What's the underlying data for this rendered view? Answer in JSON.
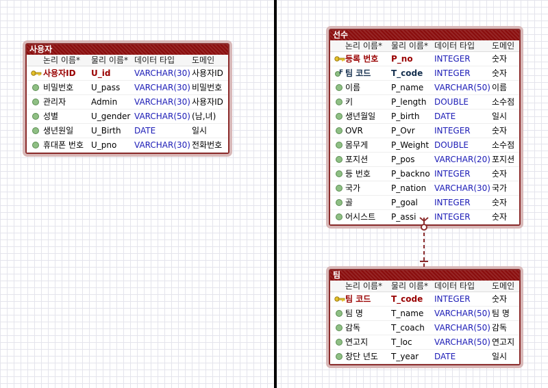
{
  "headers": {
    "logical": "논리 이름",
    "physical": "물리 이름",
    "datatype": "데이터 타입",
    "domain": "도메인"
  },
  "entities": {
    "user": {
      "title": "사용자",
      "rows": [
        {
          "logical": "사용자ID",
          "physical": "U_id",
          "type": "VARCHAR(30)",
          "domain": "사용자ID",
          "key": "pk"
        },
        {
          "logical": "비밀번호",
          "physical": "U_pass",
          "type": "VARCHAR(30)",
          "domain": "비밀번호",
          "key": ""
        },
        {
          "logical": "관리자",
          "physical": "Admin",
          "type": "VARCHAR(30)",
          "domain": "사용자ID",
          "key": ""
        },
        {
          "logical": "성별",
          "physical": "U_gender",
          "type": "VARCHAR(50)",
          "domain": "(남,녀)",
          "key": ""
        },
        {
          "logical": "생년원일",
          "physical": "U_Birth",
          "type": "DATE",
          "domain": "일시",
          "key": ""
        },
        {
          "logical": "휴대폰 번호",
          "physical": "U_pno",
          "type": "VARCHAR(30)",
          "domain": "전화번호",
          "key": ""
        }
      ]
    },
    "player": {
      "title": "선수",
      "rows": [
        {
          "logical": "등록 번호",
          "physical": "P_no",
          "type": "INTEGER",
          "domain": "숫자",
          "key": "pk"
        },
        {
          "logical": "팀 코드",
          "physical": "T_code",
          "type": "INTEGER",
          "domain": "숫자",
          "key": "fk"
        },
        {
          "logical": "이름",
          "physical": "P_name",
          "type": "VARCHAR(50)",
          "domain": "이름",
          "key": ""
        },
        {
          "logical": "키",
          "physical": "P_length",
          "type": "DOUBLE",
          "domain": "소수점",
          "key": ""
        },
        {
          "logical": "생년월일",
          "physical": "P_birth",
          "type": "DATE",
          "domain": "일시",
          "key": ""
        },
        {
          "logical": "OVR",
          "physical": "P_Ovr",
          "type": "INTEGER",
          "domain": "숫자",
          "key": ""
        },
        {
          "logical": "몸무게",
          "physical": "P_Weight",
          "type": "DOUBLE",
          "domain": "소수점",
          "key": ""
        },
        {
          "logical": "포지션",
          "physical": "P_pos",
          "type": "VARCHAR(20)",
          "domain": "포지션",
          "key": ""
        },
        {
          "logical": "등 번호",
          "physical": "P_backno",
          "type": "INTEGER",
          "domain": "숫자",
          "key": ""
        },
        {
          "logical": "국가",
          "physical": "P_nation",
          "type": "VARCHAR(30)",
          "domain": "국가",
          "key": ""
        },
        {
          "logical": "골",
          "physical": "P_goal",
          "type": "INTEGER",
          "domain": "숫자",
          "key": ""
        },
        {
          "logical": "어시스트",
          "physical": "P_assi",
          "type": "INTEGER",
          "domain": "숫자",
          "key": ""
        }
      ]
    },
    "team": {
      "title": "팀",
      "rows": [
        {
          "logical": "팀 코드",
          "physical": "T_code",
          "type": "INTEGER",
          "domain": "숫자",
          "key": "pk"
        },
        {
          "logical": "팀 명",
          "physical": "T_name",
          "type": "VARCHAR(50)",
          "domain": "팀 명",
          "key": ""
        },
        {
          "logical": "감독",
          "physical": "T_coach",
          "type": "VARCHAR(50)",
          "domain": "감독",
          "key": ""
        },
        {
          "logical": "연고지",
          "physical": "T_loc",
          "type": "VARCHAR(50)",
          "domain": "연고지",
          "key": ""
        },
        {
          "logical": "창단 년도",
          "physical": "T_year",
          "type": "DATE",
          "domain": "일시",
          "key": ""
        }
      ]
    }
  },
  "colors": {
    "title_bg": "#8a0d0d",
    "border": "#8b2b2b",
    "pk_text": "#990000",
    "fk_text": "#16304f",
    "type_text": "#1b1bb6",
    "relation": "#8b2b2b"
  }
}
